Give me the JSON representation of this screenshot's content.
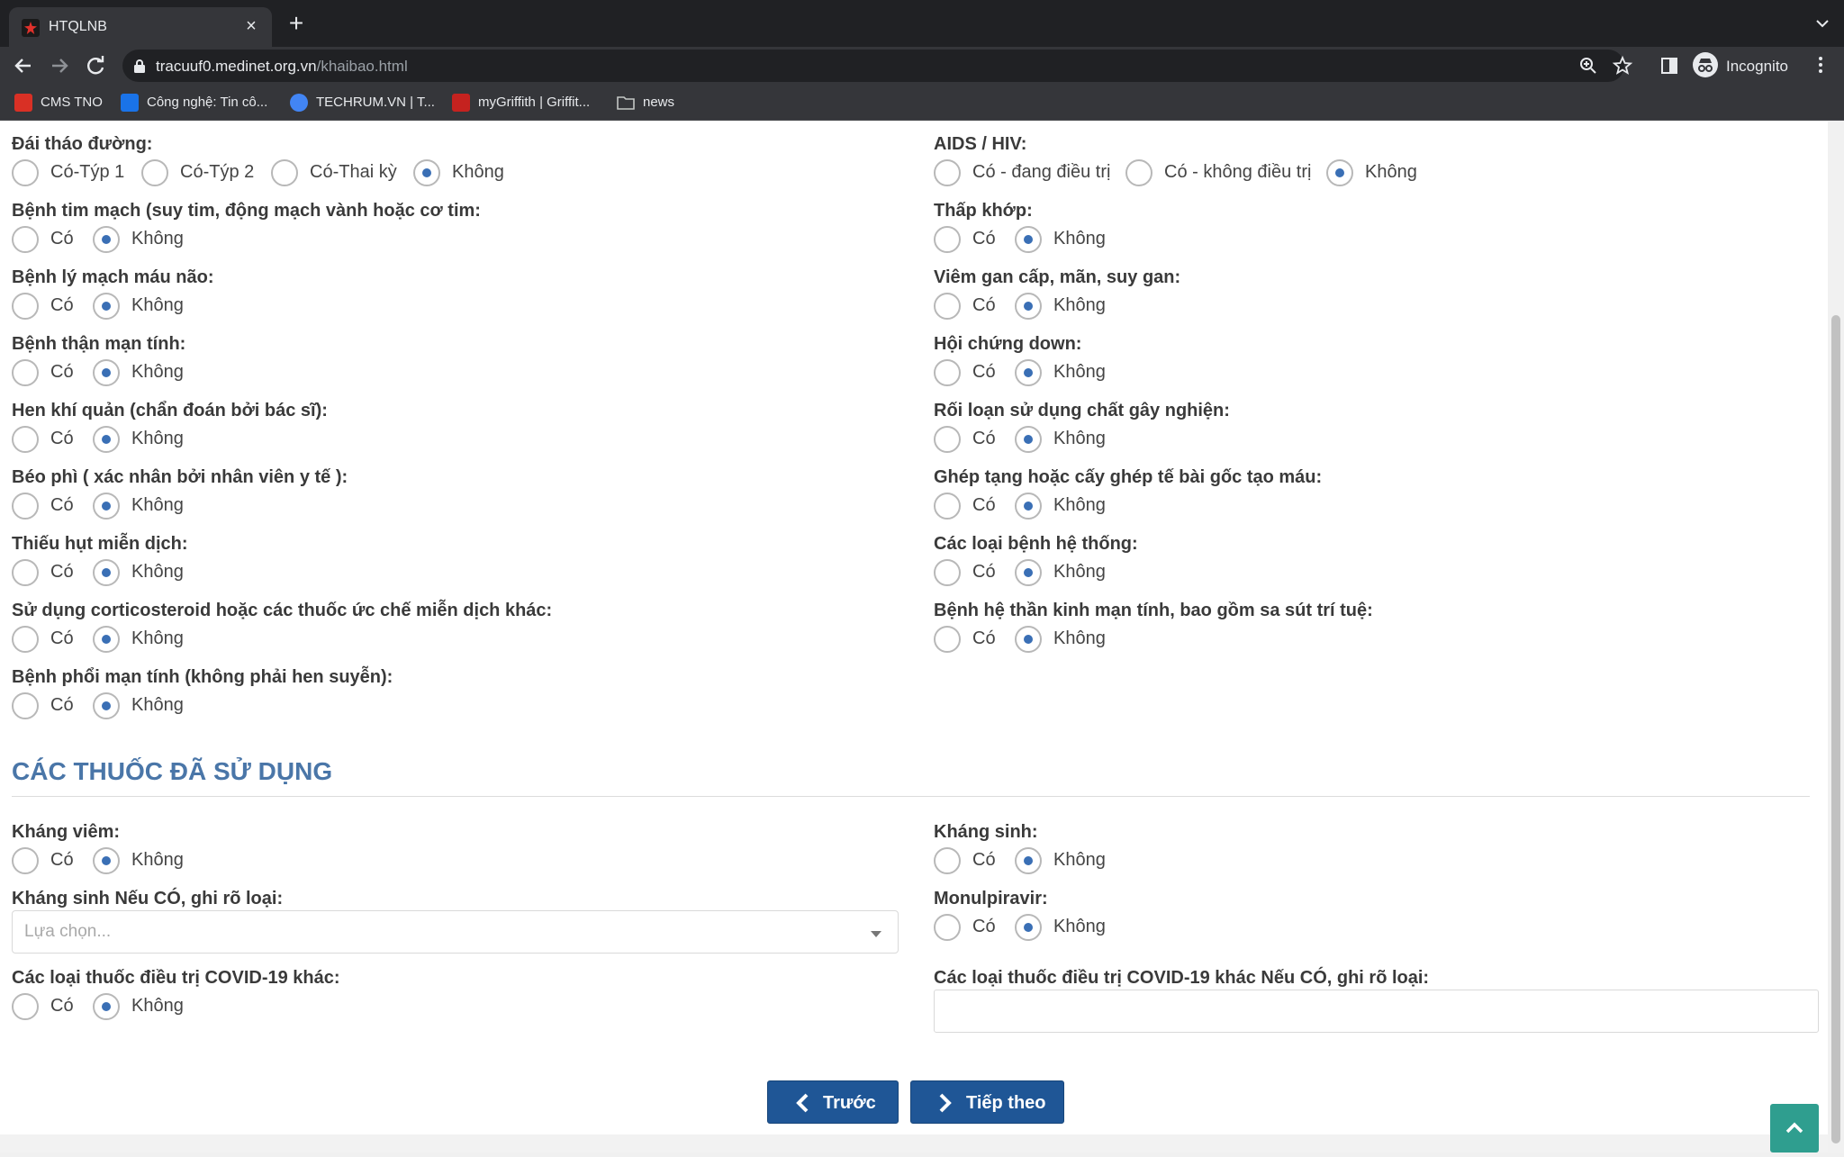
{
  "browser": {
    "tab_title": "HTQLNB",
    "url_host": "tracuuf0.medinet.org.vn",
    "url_path": "/khaibao.html",
    "profile_label": "Incognito",
    "bookmarks": [
      {
        "label": "CMS TNO",
        "color": "#d93025"
      },
      {
        "label": "Công nghệ: Tin cô...",
        "color": "#1a73e8"
      },
      {
        "label": "TECHRUM.VN | T...",
        "color": "#4285f4"
      },
      {
        "label": "myGriffith | Griffit...",
        "color": "#c5221f"
      },
      {
        "label": "news",
        "color": "#9aa0a6"
      }
    ]
  },
  "options": {
    "yes": "Có",
    "no": "Không"
  },
  "conditions": {
    "left": [
      {
        "label": "Đái tháo đường:",
        "opts": [
          "Có-Týp 1",
          "Có-Týp 2",
          "Có-Thai kỳ",
          "Không"
        ],
        "selected": 3
      },
      {
        "label": "Bệnh tim mạch (suy tim, động mạch vành hoặc cơ tim:",
        "selected": 1
      },
      {
        "label": "Bệnh lý mạch máu não:",
        "selected": 1
      },
      {
        "label": "Bệnh thận mạn tính:",
        "selected": 1
      },
      {
        "label": "Hen khí quản (chẩn đoán bởi bác sĩ):",
        "selected": 1
      },
      {
        "label": "Béo phì ( xác nhân bởi nhân viên y tế ):",
        "selected": 1
      },
      {
        "label": "Thiếu hụt miễn dịch:",
        "selected": 1
      },
      {
        "label": "Sử dụng corticosteroid hoặc các thuốc ức chế miễn dịch khác:",
        "selected": 1
      },
      {
        "label": "Bệnh phổi mạn tính (không phải hen suyễn):",
        "selected": 1
      }
    ],
    "right": [
      {
        "label": "AIDS / HIV:",
        "opts": [
          "Có - đang điều trị",
          "Có - không điều trị",
          "Không"
        ],
        "selected": 2
      },
      {
        "label": "Thấp khớp:",
        "selected": 1
      },
      {
        "label": "Viêm gan cấp, mãn, suy gan:",
        "selected": 1
      },
      {
        "label": "Hội chứng down:",
        "selected": 1
      },
      {
        "label": "Rối loạn sử dụng chất gây nghiện:",
        "selected": 1
      },
      {
        "label": "Ghép tạng hoặc cấy ghép tế bài gốc tạo máu:",
        "selected": 1
      },
      {
        "label": "Các loại bệnh hệ thống:",
        "selected": 1
      },
      {
        "label": "Bệnh hệ thần kinh mạn tính, bao gồm sa sút trí tuệ:",
        "selected": 1
      }
    ]
  },
  "drugs_section": {
    "title": "CÁC THUỐC ĐÃ SỬ DỤNG",
    "anti_inflammatory": {
      "label": "Kháng viêm:",
      "selected": 1
    },
    "antibiotic": {
      "label": "Kháng sinh:",
      "selected": 1
    },
    "antibiotic_type": {
      "label": "Kháng sinh Nếu CÓ, ghi rõ loại:",
      "placeholder": "Lựa chọn..."
    },
    "molnupiravir": {
      "label": "Monulpiravir:",
      "selected": 1
    },
    "other_covid": {
      "label": "Các loại thuốc điều trị COVID-19 khác:",
      "selected": 1
    },
    "other_covid_type": {
      "label": "Các loại thuốc điều trị COVID-19 khác Nếu CÓ, ghi rõ loại:",
      "value": ""
    }
  },
  "nav": {
    "prev": "Trước",
    "next": "Tiếp theo"
  },
  "colors": {
    "accent": "#1f5696",
    "section_title": "#4a76a8",
    "radio_dot": "#3a6fb5",
    "scroll_top": "#2f9e8f"
  }
}
